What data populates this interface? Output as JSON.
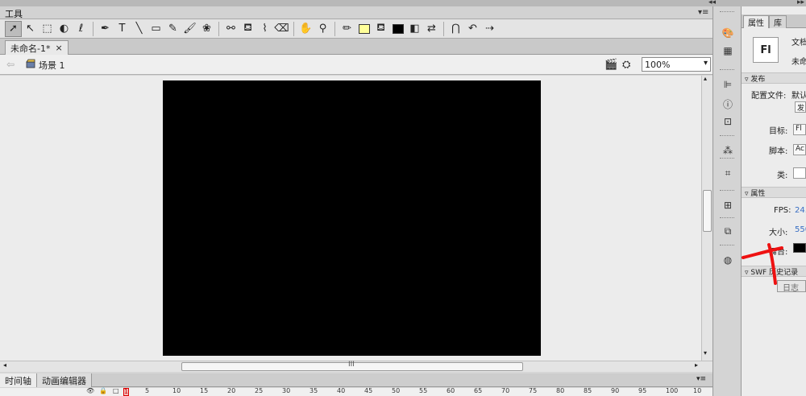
{
  "tools_panel": {
    "title": "工具",
    "menu_glyph": "▾≡"
  },
  "top_collapse": {
    "left": "◂◂",
    "right": "▸▸"
  },
  "toolbar": {
    "icons": [
      {
        "name": "selection-tool-icon",
        "glyph": "➚",
        "selected": true
      },
      {
        "name": "subselection-tool-icon",
        "glyph": "↖"
      },
      {
        "name": "free-transform-tool-icon",
        "glyph": "⬚"
      },
      {
        "name": "3d-rotation-tool-icon",
        "glyph": "◐"
      },
      {
        "name": "lasso-tool-icon",
        "glyph": "ℓ"
      },
      {
        "sep": true
      },
      {
        "name": "pen-tool-icon",
        "glyph": "✒"
      },
      {
        "name": "text-tool-icon",
        "glyph": "T"
      },
      {
        "name": "line-tool-icon",
        "glyph": "╲"
      },
      {
        "name": "rectangle-tool-icon",
        "glyph": "▭"
      },
      {
        "name": "pencil-tool-icon",
        "glyph": "✎"
      },
      {
        "name": "brush-tool-icon",
        "glyph": "🖌"
      },
      {
        "name": "deco-tool-icon",
        "glyph": "❀"
      },
      {
        "sep": true
      },
      {
        "name": "bone-tool-icon",
        "glyph": "⚯"
      },
      {
        "name": "paint-bucket-tool-icon",
        "glyph": "⛾"
      },
      {
        "name": "eyedropper-tool-icon",
        "glyph": "⌇"
      },
      {
        "name": "eraser-tool-icon",
        "glyph": "⌫"
      },
      {
        "sep": true
      },
      {
        "name": "hand-tool-icon",
        "glyph": "✋"
      },
      {
        "name": "zoom-tool-icon",
        "glyph": "⚲"
      },
      {
        "sep": true
      },
      {
        "name": "stroke-color-icon",
        "glyph": "✏"
      },
      {
        "name": "stroke-color-swatch",
        "swatch": "#ffff99"
      },
      {
        "name": "fill-color-icon",
        "glyph": "⛾"
      },
      {
        "name": "fill-color-swatch",
        "swatch": "#000000"
      },
      {
        "name": "black-white-icon",
        "glyph": "◧"
      },
      {
        "name": "swap-colors-icon",
        "glyph": "⇄"
      },
      {
        "sep": true
      },
      {
        "name": "snap-magnet-icon",
        "glyph": "⋂"
      },
      {
        "name": "smooth-icon",
        "glyph": "↶"
      },
      {
        "name": "straighten-icon",
        "glyph": "⇢"
      }
    ]
  },
  "doc_tab": {
    "title": "未命名-1*",
    "close": "×"
  },
  "edit_bar": {
    "back": "⇦",
    "scene": "场景 1",
    "zoom": "100%",
    "zoom_arrow": "▾",
    "edit_scene_glyph": "🎬",
    "edit_symbol_glyph": "⛭"
  },
  "scroll": {
    "up": "▴",
    "down": "▾",
    "left": "◂",
    "right": "▸",
    "grip": "III"
  },
  "timeline": {
    "tabs": [
      "时间轴",
      "动画编辑器"
    ],
    "menu": "▾≡",
    "icons": [
      "👁",
      "🔒",
      "□"
    ],
    "playhead": "1",
    "frames": [
      "5",
      "10",
      "15",
      "20",
      "25",
      "30",
      "35",
      "40",
      "45",
      "50",
      "55",
      "60",
      "65",
      "70",
      "75",
      "80",
      "85",
      "90",
      "95",
      "100",
      "10"
    ]
  },
  "panel_strip": {
    "icons": [
      "color-palette-icon",
      "swatches-icon",
      "align-icon",
      "info-icon",
      "transform-icon",
      "components-icon",
      "code-snippets-icon",
      "library-panel-icon",
      "movie-explorer-icon",
      "motion-presets-icon"
    ]
  },
  "properties": {
    "tabs": [
      "属性",
      "库"
    ],
    "doc_icon": "Fl",
    "doc_type": "文档",
    "doc_name": "未命",
    "publish_section": "发布",
    "profile_label": "配置文件:",
    "profile_value": "默认",
    "publish_button": "发",
    "target_label": "目标:",
    "target_value": "Fl",
    "script_label": "脚本:",
    "script_value": "Ac",
    "class_label": "类:",
    "properties_section": "属性",
    "fps_label": "FPS:",
    "fps_value": "24.",
    "size_label": "大小:",
    "size_value": "550",
    "stage_label": "舞台:",
    "stage_color": "#000000",
    "swf_section": "SWF",
    "history_label": "历史记录",
    "log_button": "日志"
  },
  "annotation_color": "#ee1111"
}
